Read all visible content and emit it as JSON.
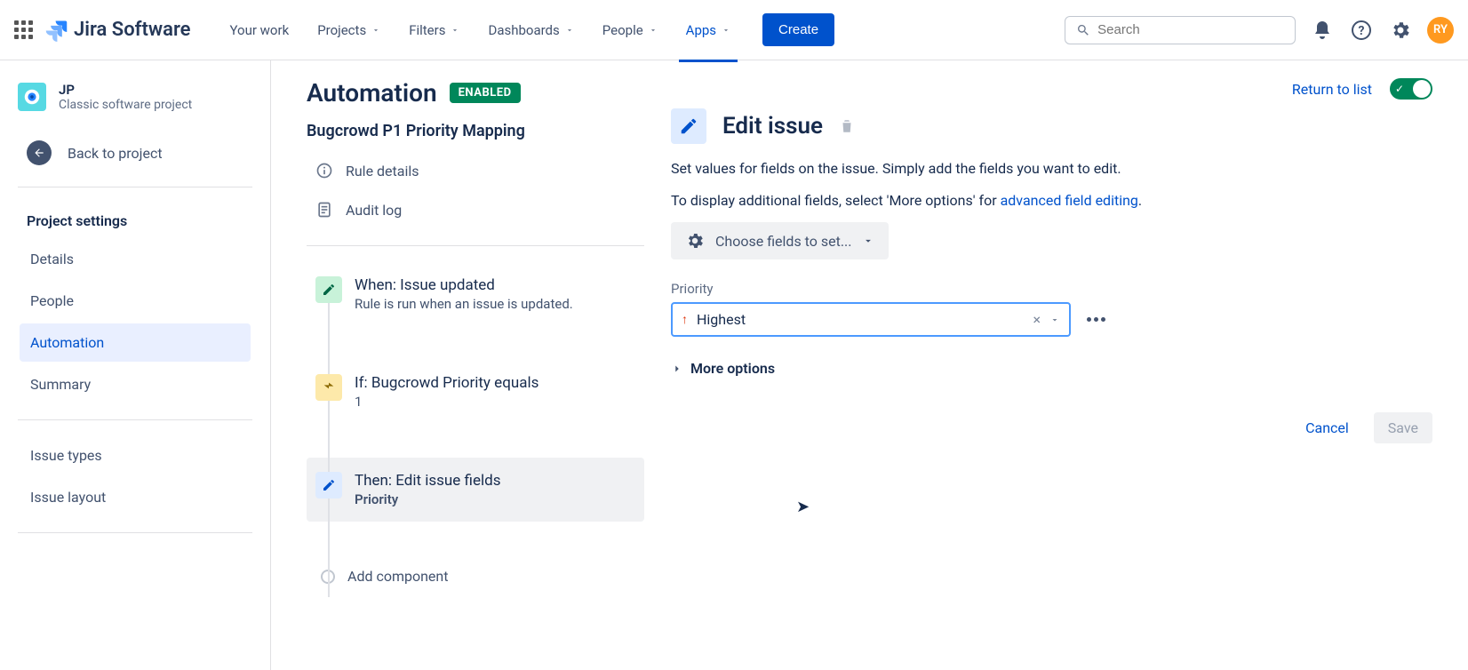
{
  "nav": {
    "product": "Jira Software",
    "items": [
      "Your work",
      "Projects",
      "Filters",
      "Dashboards",
      "People",
      "Apps"
    ],
    "create": "Create",
    "search_placeholder": "Search",
    "avatar": "RY"
  },
  "sidebar": {
    "project_key": "JP",
    "project_type": "Classic software project",
    "back": "Back to project",
    "section_title": "Project settings",
    "items": [
      "Details",
      "People",
      "Automation",
      "Summary"
    ],
    "group2": [
      "Issue types",
      "Issue layout"
    ]
  },
  "main": {
    "title": "Automation",
    "badge": "ENABLED",
    "rule_name": "Bugcrowd P1 Priority Mapping",
    "rule_links": [
      "Rule details",
      "Audit log"
    ],
    "steps": [
      {
        "title": "When: Issue updated",
        "sub": "Rule is run when an issue is updated."
      },
      {
        "title": "If: Bugcrowd Priority equals",
        "sub": "1"
      },
      {
        "title": "Then: Edit issue fields",
        "sub": "Priority"
      }
    ],
    "add_component": "Add component"
  },
  "panel": {
    "return": "Return to list",
    "title": "Edit issue",
    "desc1": "Set values for fields on the issue. Simply add the fields you want to edit.",
    "desc2a": "To display additional fields, select 'More options' for ",
    "desc2b": "advanced field editing",
    "choose_fields": "Choose fields to set...",
    "priority_label": "Priority",
    "priority_value": "Highest",
    "more_options": "More options",
    "cancel": "Cancel",
    "save": "Save"
  }
}
